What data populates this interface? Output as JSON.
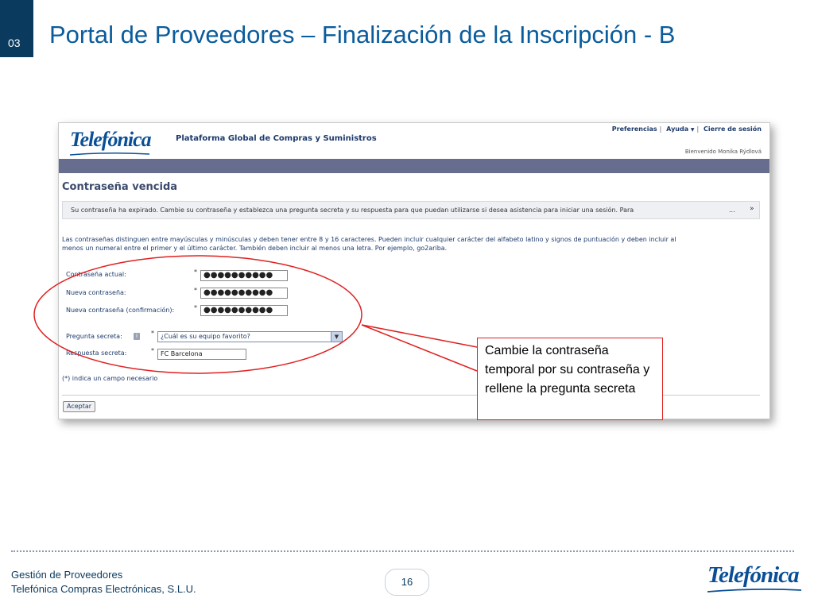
{
  "slide": {
    "section_number": "03",
    "title": "Portal de Proveedores – Finalización de la Inscripción - B"
  },
  "app": {
    "logo_text": "Telefónica",
    "name": "Plataforma Global de Compras y Suministros",
    "top_links": [
      "Preferencias",
      "Ayuda",
      "Cierre de sesión"
    ],
    "help_caret": "▼",
    "welcome": "Bienvenido Monika Rýdlová"
  },
  "page": {
    "heading": "Contraseña vencida",
    "message": "Su contraseña ha expirado. Cambie su contraseña y establezca una pregunta secreta y su respuesta para que puedan utilizarse si desea asistencia para iniciar una sesión. Para",
    "message_more": "...",
    "message_chevron": "»",
    "rules_line1": "Las contraseñas distinguen entre mayúsculas y minúsculas y deben tener entre 8 y 16 caracteres. Pueden incluir cualquier carácter del alfabeto latino y signos de puntuación y deben incluir al",
    "rules_line2": "menos un numeral entre el primer y el último carácter. También deben incluir al menos una letra. Por ejemplo, go2ariba."
  },
  "form": {
    "required_mark": "*",
    "current_password_label": "Contraseña actual:",
    "current_password_value": "●●●●●●●●●●",
    "new_password_label": "Nueva contraseña:",
    "new_password_value": "●●●●●●●●●●",
    "confirm_password_label": "Nueva contraseña (confirmación):",
    "confirm_password_value": "●●●●●●●●●●",
    "secret_question_label": "Pregunta secreta:",
    "info_icon_glyph": "i",
    "secret_question_value": "¿Cuál es su equipo favorito?",
    "select_arrow": "▼",
    "secret_answer_label": "Respuesta secreta:",
    "secret_answer_value": "FC Barcelona",
    "required_note": "(*) indica un campo necesario",
    "accept_button": "Aceptar"
  },
  "callout": {
    "text": "Cambie la contraseña temporal por su contraseña y rellene la pregunta secreta"
  },
  "footer": {
    "company_line1": "Gestión de Proveedores",
    "company_line2": "Telefónica Compras Electrónicas, S.L.U.",
    "page_number": "16",
    "logo_text": "Telefónica"
  },
  "colors": {
    "title_blue": "#0a5c9c",
    "section_tab": "#0a3a5e",
    "nav_bar": "#666d8f",
    "callout_red": "#e02020"
  }
}
